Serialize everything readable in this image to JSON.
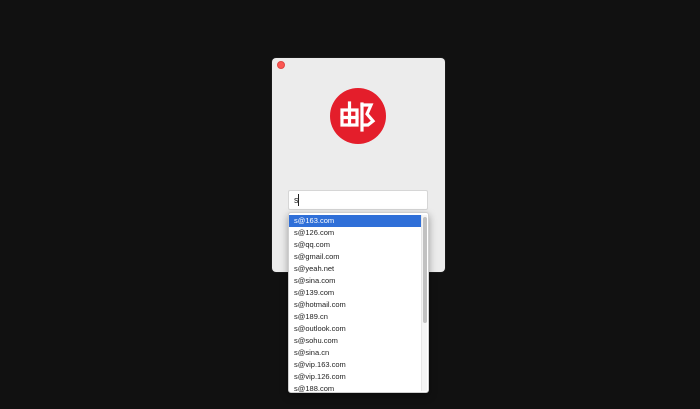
{
  "window": {
    "logo": {
      "icon": "mail-logo-icon",
      "glyph": "邮",
      "color": "#e41e2b"
    },
    "email_input": {
      "value": "s"
    }
  },
  "autocomplete": {
    "selected_index": 0,
    "items": [
      "s@163.com",
      "s@126.com",
      "s@qq.com",
      "s@gmail.com",
      "s@yeah.net",
      "s@sina.com",
      "s@139.com",
      "s@hotmail.com",
      "s@189.cn",
      "s@outlook.com",
      "s@sohu.com",
      "s@sina.cn",
      "s@vip.163.com",
      "s@vip.126.com",
      "s@188.com"
    ]
  }
}
